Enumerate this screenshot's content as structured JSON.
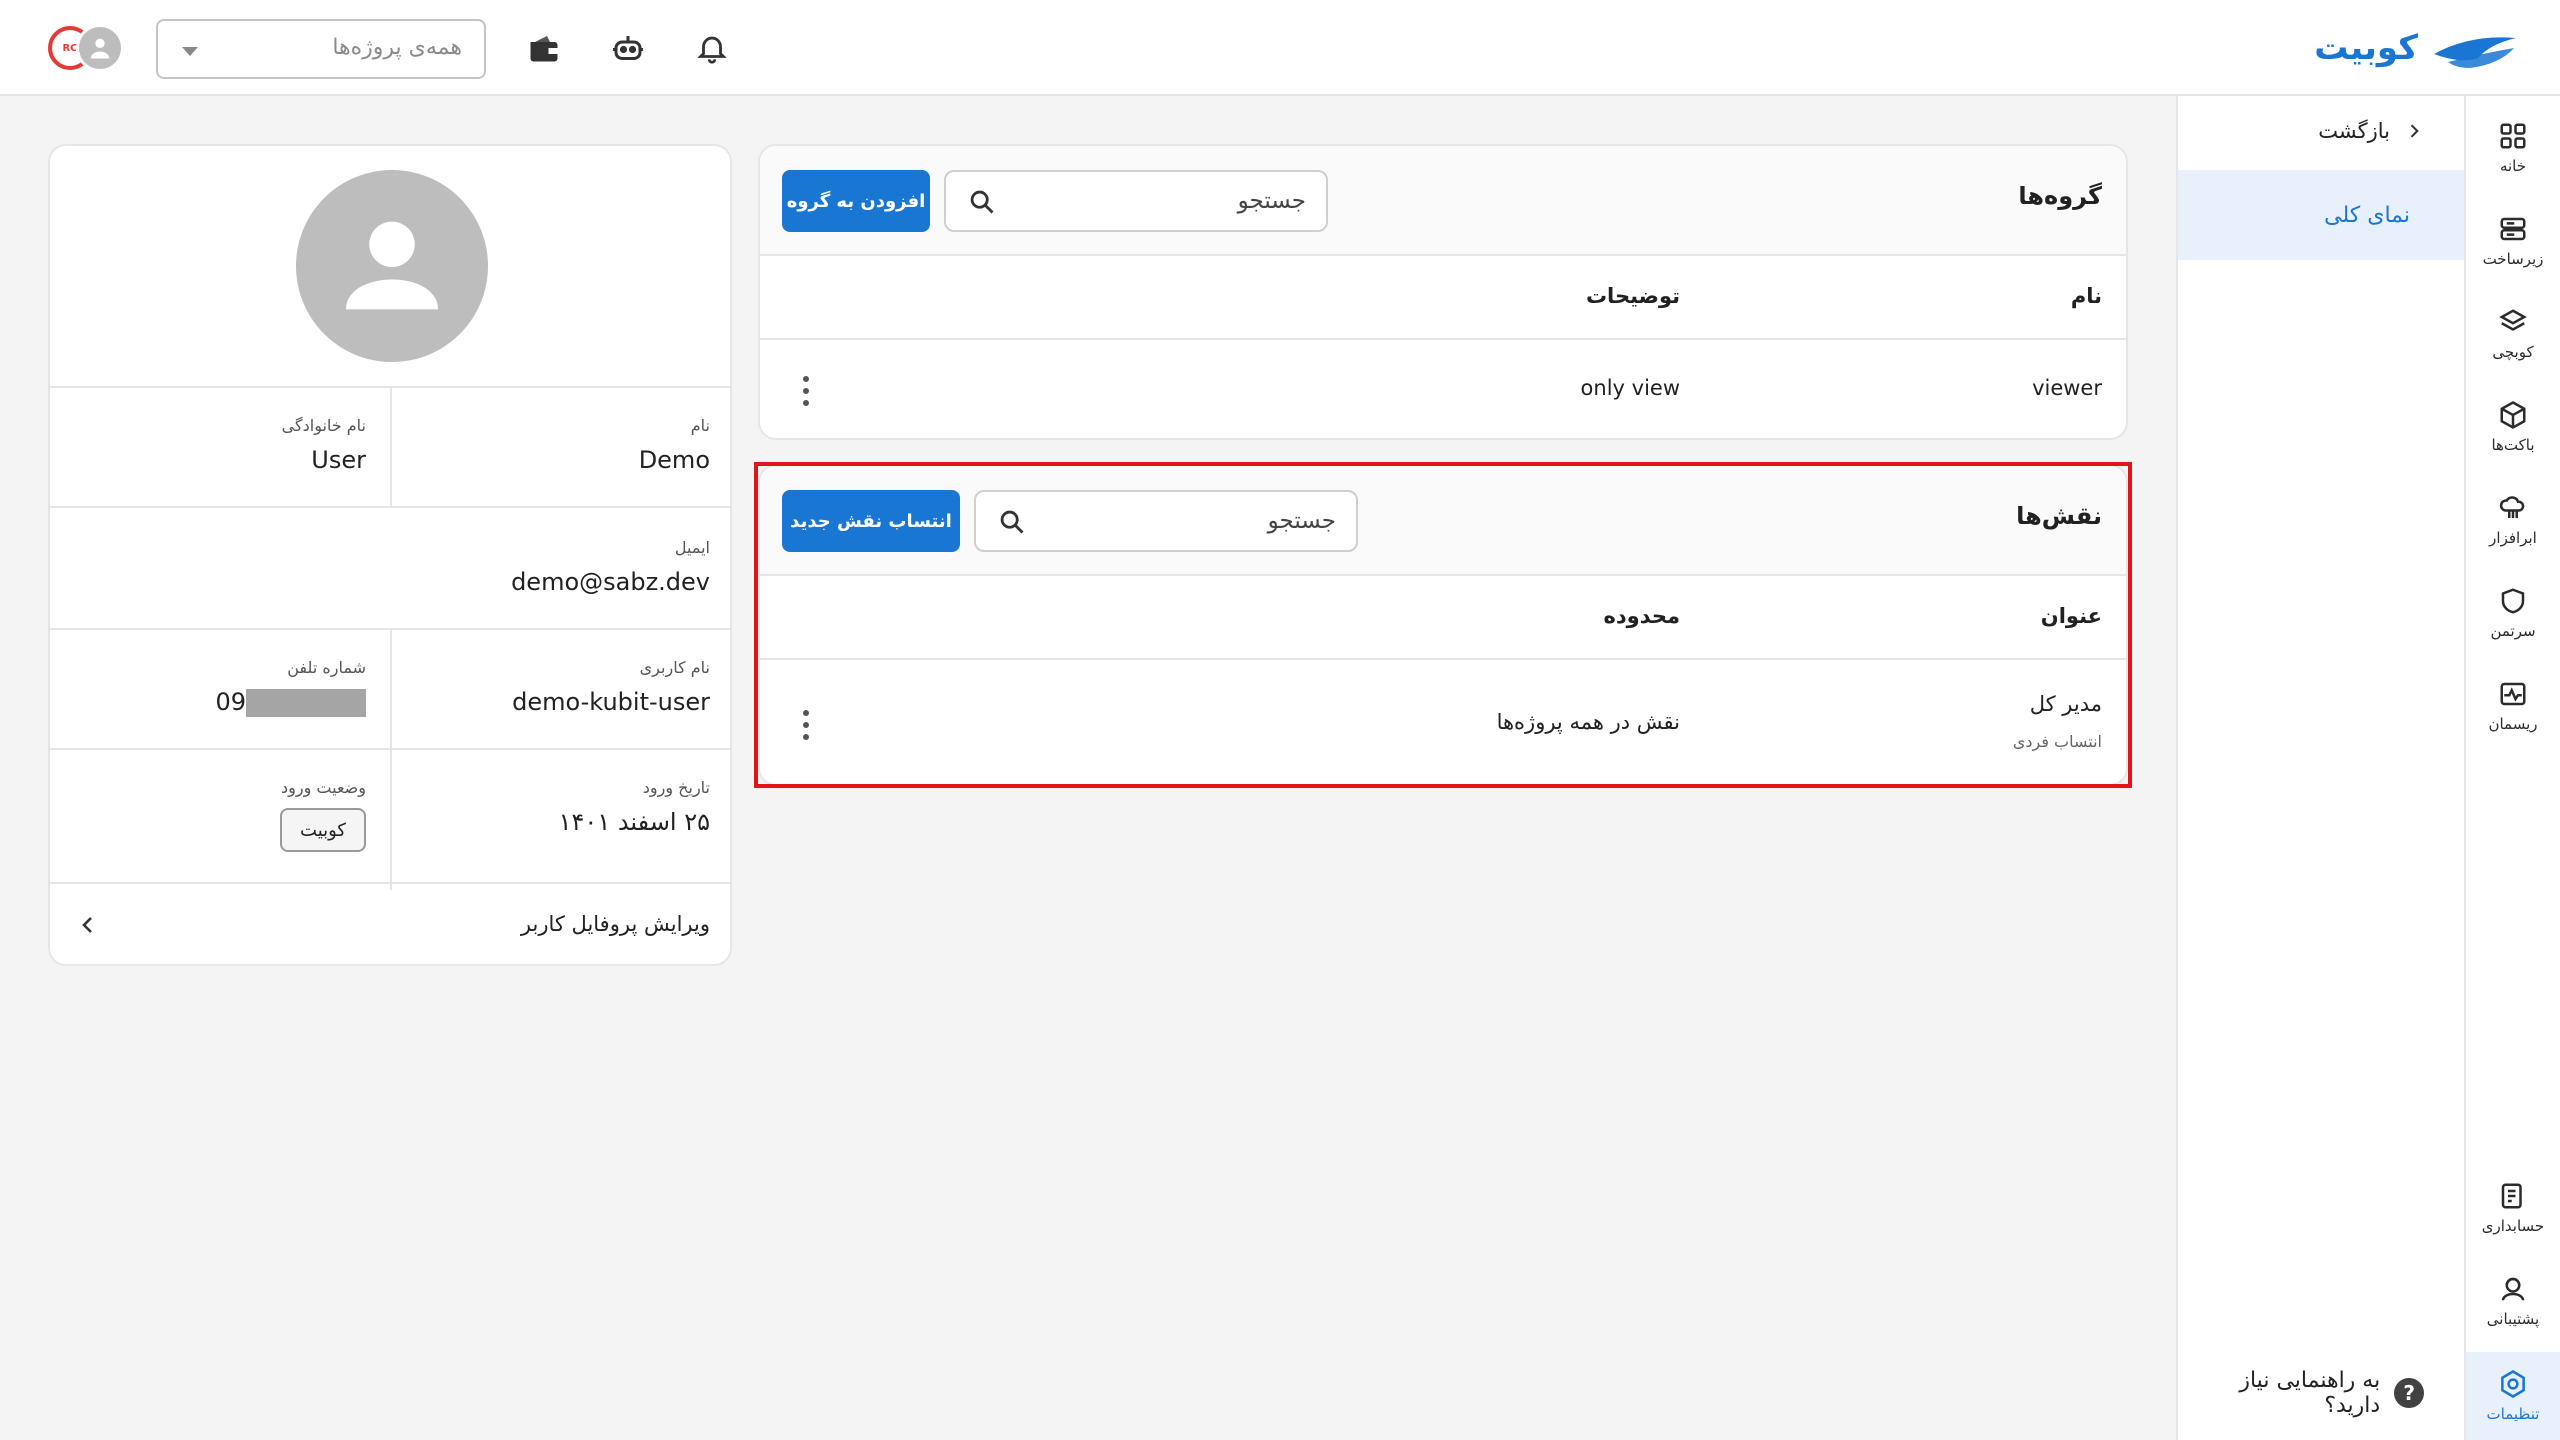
{
  "topbar": {
    "logo_text": "کوبیت",
    "project_select": {
      "placeholder": "همه‌ی پروژه‌ها"
    },
    "icons": [
      "bell-icon",
      "robot-icon",
      "wallet-icon"
    ],
    "avatar_badge": "RC"
  },
  "rail": {
    "items": [
      {
        "label": "خانه",
        "icon": "grid-icon"
      },
      {
        "label": "زیرساخت",
        "icon": "server-icon"
      },
      {
        "label": "کوبچی",
        "icon": "layers-icon"
      },
      {
        "label": "باکت‌ها",
        "icon": "cube-icon"
      },
      {
        "label": "ابرافزار",
        "icon": "cloud-app-icon"
      },
      {
        "label": "سرتمن",
        "icon": "shield-icon"
      },
      {
        "label": "ریسمان",
        "icon": "pulse-icon"
      }
    ],
    "bottom_items": [
      {
        "label": "حسابداری",
        "icon": "billing-icon"
      },
      {
        "label": "پشتیبانی",
        "icon": "support-icon"
      },
      {
        "label": "تنظیمات",
        "icon": "settings-icon"
      }
    ]
  },
  "subside": {
    "back_label": "بازگشت",
    "overview_label": "نمای کلی",
    "help_label": "به راهنمایی نیاز دارید؟",
    "help_glyph": "?"
  },
  "groups": {
    "title": "گروه‌ها",
    "search_placeholder": "جستجو",
    "add_button": "افزودن به گروه",
    "columns": {
      "name": "نام",
      "description": "توضیحات"
    },
    "rows": [
      {
        "name": "viewer",
        "description": "only view"
      }
    ]
  },
  "roles": {
    "title": "نقش‌ها",
    "search_placeholder": "جستجو",
    "assign_button": "انتساب نقش جدید",
    "columns": {
      "title": "عنوان",
      "scope": "محدوده"
    },
    "rows": [
      {
        "title": "مدیر کل",
        "subtitle": "انتساب فردی",
        "scope": "نقش در همه پروژه‌ها"
      }
    ]
  },
  "profile": {
    "first_name_label": "نام",
    "first_name": "Demo",
    "last_name_label": "نام خانوادگی",
    "last_name": "User",
    "email_label": "ایمیل",
    "email": "demo@sabz.dev",
    "username_label": "نام کاربری",
    "username": "demo-kubit-user",
    "phone_label": "شماره تلفن",
    "phone_prefix": "09",
    "login_date_label": "تاریخ ورود",
    "login_date": "۲۵ اسفند ۱۴۰۱",
    "login_status_label": "وضعیت ورود",
    "login_status": "کوبیت",
    "edit_label": "ویرایش پروفایل کاربر"
  },
  "colors": {
    "accent": "#1976d2",
    "highlight": "#e0141b"
  }
}
